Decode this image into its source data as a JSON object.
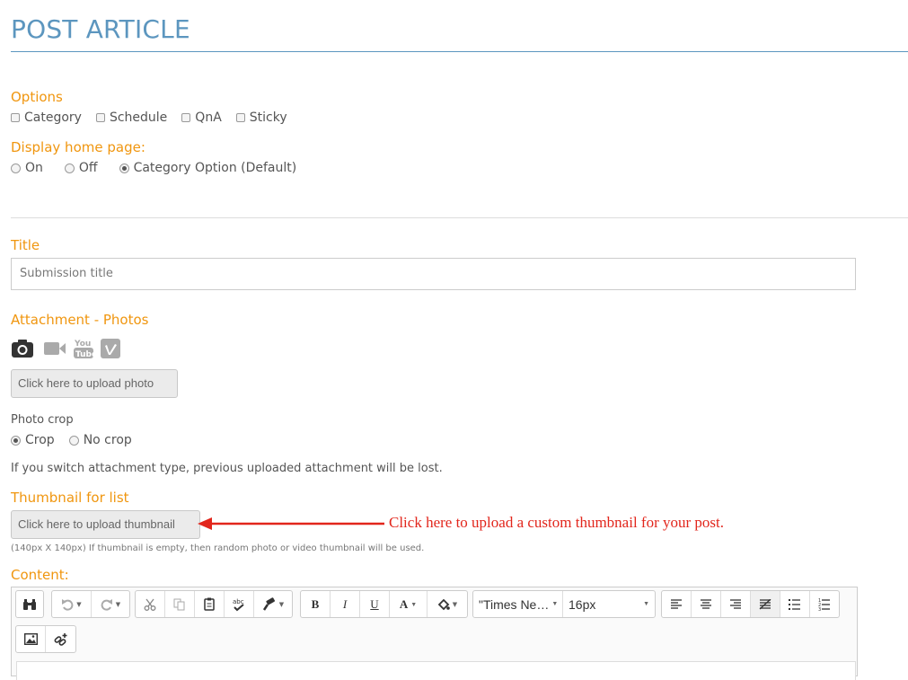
{
  "page": {
    "title": "POST ARTICLE"
  },
  "options": {
    "label": "Options",
    "checkboxes": [
      "Category",
      "Schedule",
      "QnA",
      "Sticky"
    ]
  },
  "display_home": {
    "label": "Display home page:",
    "radios": [
      "On",
      "Off",
      "Category Option (Default)"
    ],
    "selected": "Category Option (Default)"
  },
  "title_field": {
    "label": "Title",
    "placeholder": "Submission title"
  },
  "attachment": {
    "label": "Attachment - Photos",
    "types": [
      "camera-icon",
      "video-icon",
      "youtube-icon",
      "vimeo-icon"
    ],
    "upload_label": "Click here to upload photo"
  },
  "photo_crop": {
    "label": "Photo crop",
    "radios": [
      "Crop",
      "No crop"
    ],
    "selected": "Crop"
  },
  "switch_note": "If you switch attachment type, previous uploaded attachment will be lost.",
  "thumbnail": {
    "label": "Thumbnail for list",
    "upload_label": "Click here to upload thumbnail",
    "note": "(140px X 140px) If thumbnail is empty, then random photo or video thumbnail will be used."
  },
  "annotation": "Click here to upload a custom thumbnail for your post.",
  "content": {
    "label": "Content:",
    "toolbar": {
      "font_family": "\"Times Ne…",
      "font_size": "16px",
      "bold": "B",
      "italic": "I",
      "underline": "U",
      "font_color": "A"
    }
  },
  "colors": {
    "accent": "#f0960f",
    "title": "#5c96bf",
    "annotation": "#e2261c"
  }
}
